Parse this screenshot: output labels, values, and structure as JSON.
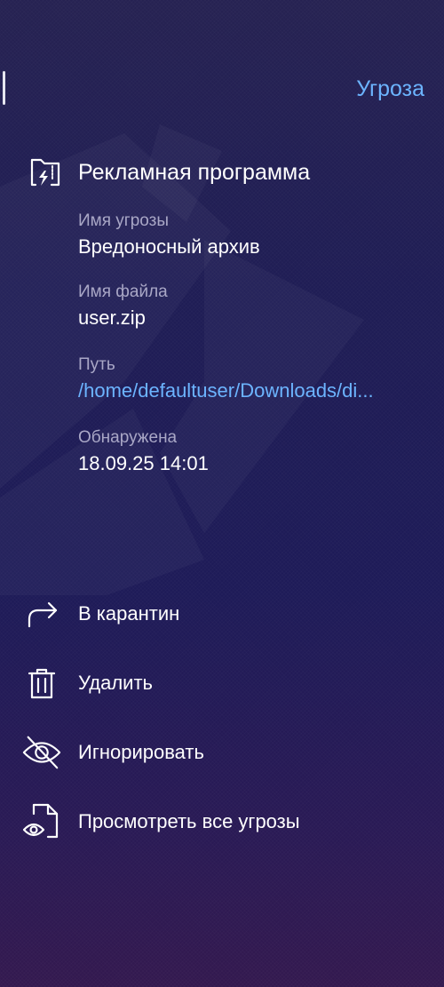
{
  "header": {
    "title": "Угроза"
  },
  "threat": {
    "type_label": "Рекламная программа",
    "details": [
      {
        "label": "Имя угрозы",
        "value": "Вредоносный архив"
      },
      {
        "label": "Имя файла",
        "value": "user.zip"
      },
      {
        "label": "Путь",
        "value": "/home/defaultuser/Downloads/di..."
      },
      {
        "label": "Обнаружена",
        "value": "18.09.25 14:01"
      }
    ]
  },
  "actions": [
    {
      "label": "В карантин",
      "icon": "forward-arrow-icon"
    },
    {
      "label": "Удалить",
      "icon": "trash-icon"
    },
    {
      "label": "Игнорировать",
      "icon": "eye-off-icon"
    },
    {
      "label": "Просмотреть все угрозы",
      "icon": "document-eye-icon"
    }
  ],
  "colors": {
    "accent": "#6cb4ff",
    "muted": "#a9a7c6",
    "background": "#1f1d55"
  }
}
